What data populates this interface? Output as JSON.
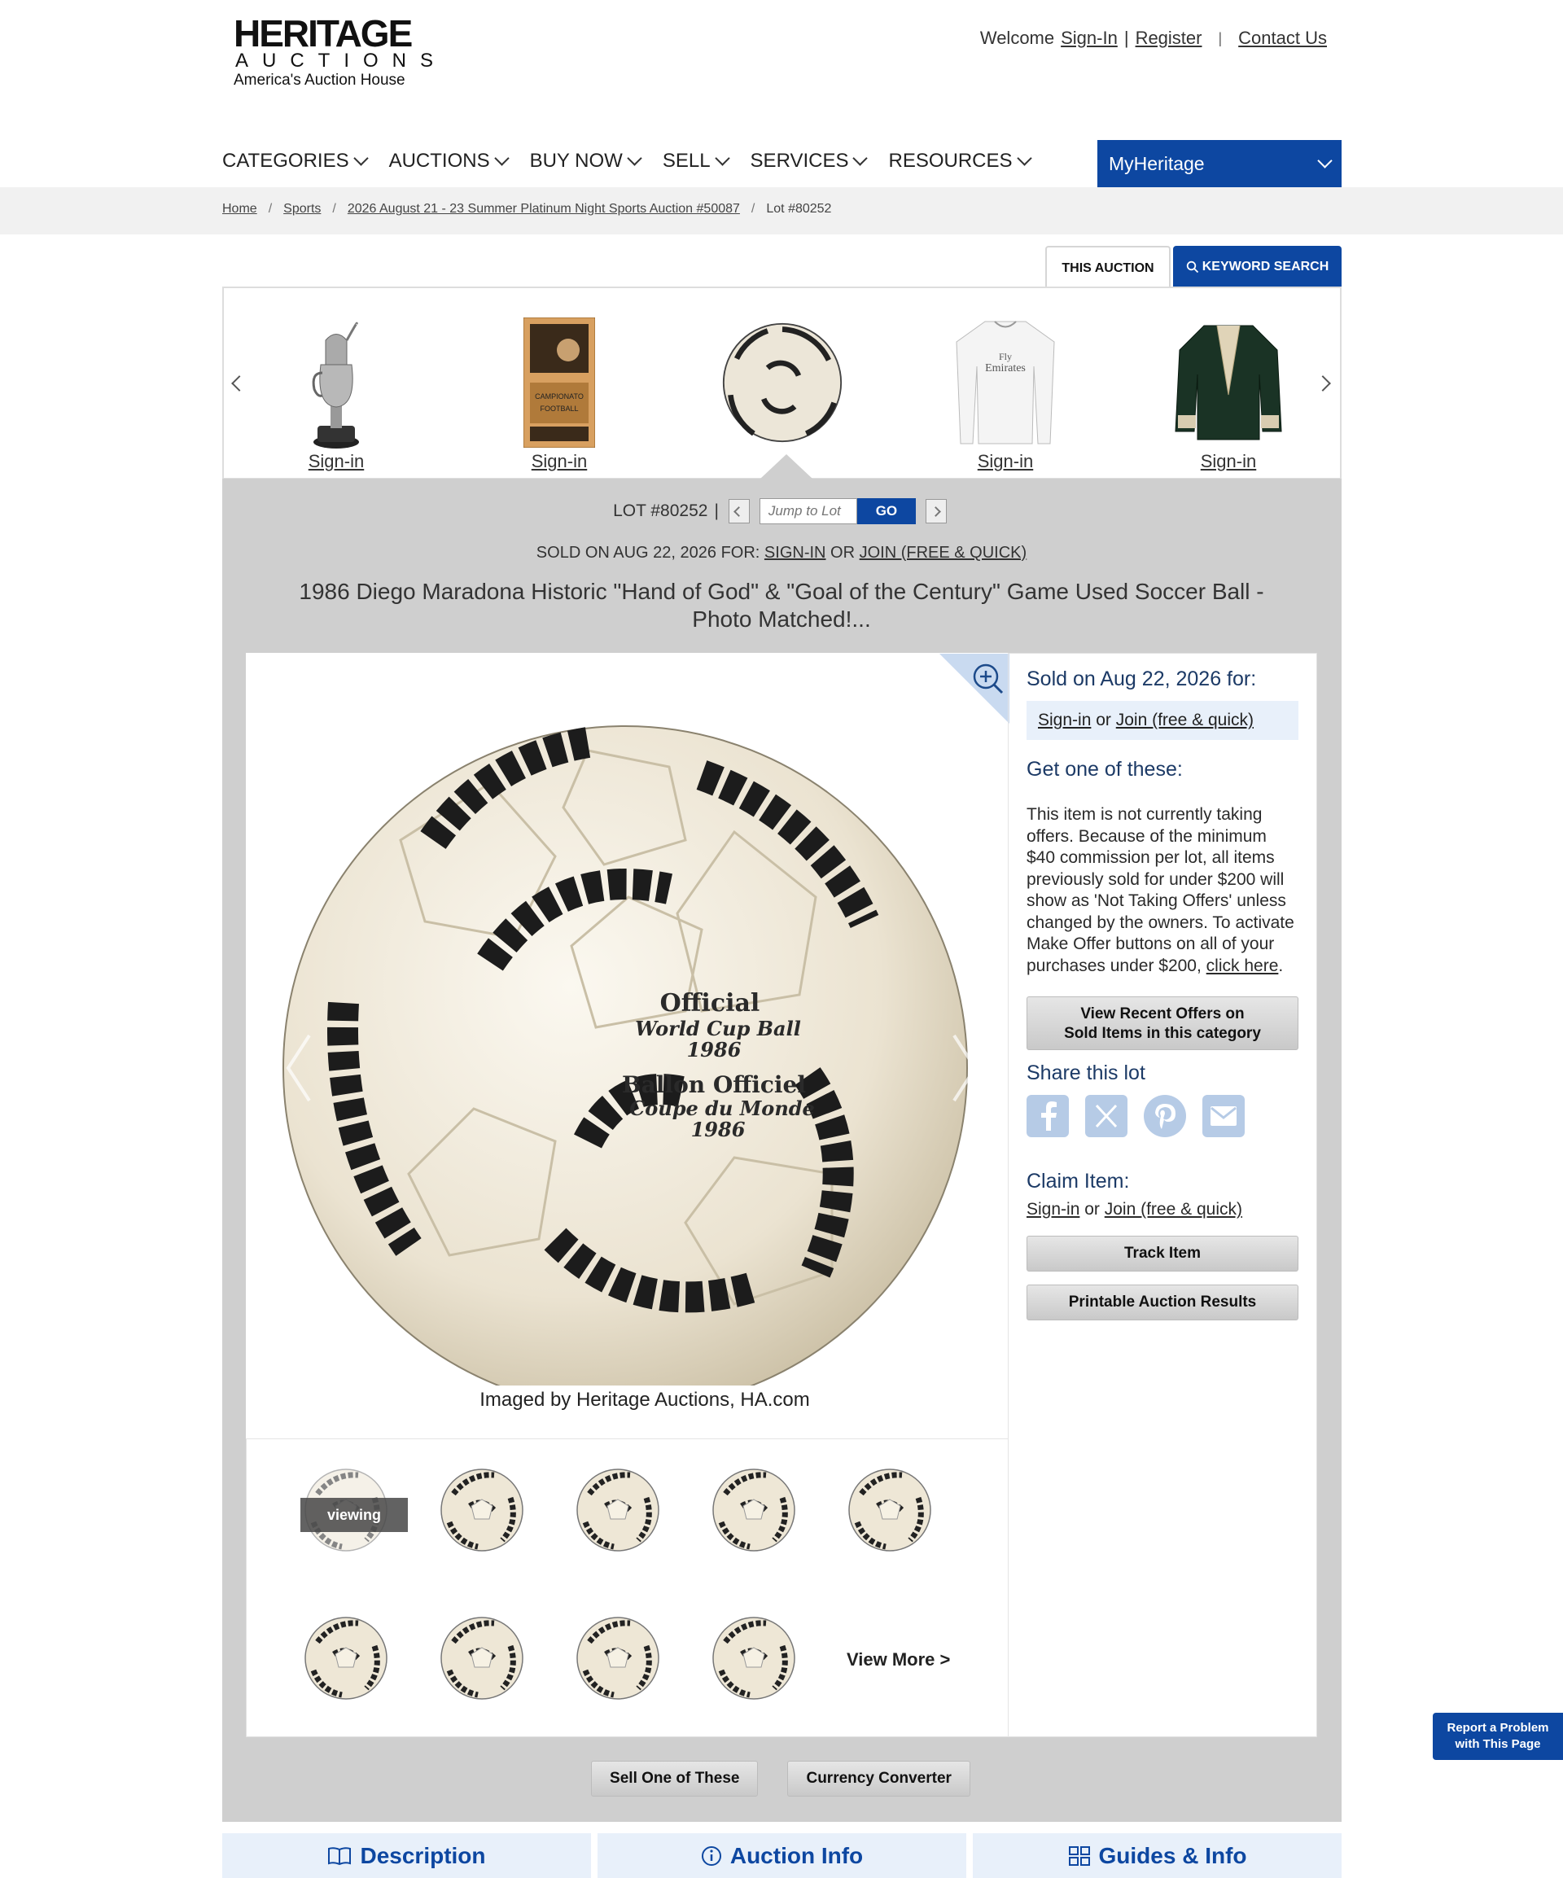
{
  "header": {
    "logo_line1": "HERITAGE",
    "logo_line2": "AUCTIONS",
    "logo_line3": "America's Auction House",
    "welcome": "Welcome",
    "sign_in": "Sign-In",
    "pipe": "|",
    "register": "Register",
    "contact": "Contact Us"
  },
  "nav": {
    "items": [
      "CATEGORIES",
      "AUCTIONS",
      "BUY NOW",
      "SELL",
      "SERVICES",
      "RESOURCES"
    ],
    "myheritage": "MyHeritage"
  },
  "breadcrumb": {
    "home": "Home",
    "sports": "Sports",
    "auction": "2026 August 21 - 23 Summer Platinum Night Sports Auction #50087",
    "lot": "Lot #80252",
    "sep": "/"
  },
  "tabs": {
    "this_auction": "THIS AUCTION",
    "keyword_search": "KEYWORD SEARCH"
  },
  "carousel": {
    "items": [
      {
        "label": "Sign-in",
        "icon": "claret-jug-trophy"
      },
      {
        "label": "Sign-in",
        "icon": "vintage-poster"
      },
      {
        "label": "",
        "icon": "soccer-ball"
      },
      {
        "label": "Sign-in",
        "icon": "white-jersey"
      },
      {
        "label": "Sign-in",
        "icon": "green-jacket"
      }
    ]
  },
  "lot": {
    "lot_label": "LOT #80252",
    "pipe": "|",
    "jump_placeholder": "Jump to Lot",
    "go": "GO",
    "sold_prefix": "SOLD ON AUG 22, 2026 FOR:",
    "sold_signin": "SIGN-IN",
    "sold_or": "OR",
    "sold_join": "JOIN (FREE & QUICK)",
    "title": "1986 Diego Maradona Historic \"Hand of God\" & \"Goal of the Century\" Game Used Soccer Ball - Photo Matched!..."
  },
  "image": {
    "caption": "Imaged by Heritage Auctions, HA.com",
    "ball_text": [
      "Official",
      "World Cup Ball",
      "1986",
      "Ballon Officiel",
      "Coupe du Monde",
      "1986"
    ],
    "viewing": "viewing",
    "view_more": "View More >"
  },
  "sidebar": {
    "sold_heading": "Sold on Aug 22, 2026 for:",
    "signin": "Sign-in",
    "or": "or",
    "join": "Join (free & quick)",
    "get_one": "Get one of these:",
    "paragraph": "This item is not currently taking offers. Because of the minimum $40 commission per lot, all items previously sold for under $200 will show as 'Not Taking Offers' unless changed by the owners. To activate Make Offer buttons on all of your purchases under $200,",
    "click_here": "click here",
    "period": ".",
    "view_offers_btn_l1": "View Recent Offers on",
    "view_offers_btn_l2": "Sold Items in this category",
    "share_heading": "Share this lot",
    "share_icons": [
      "facebook-icon",
      "x-icon",
      "pinterest-icon",
      "email-icon"
    ],
    "claim_heading": "Claim Item:",
    "track_btn": "Track Item",
    "print_btn": "Printable Auction Results"
  },
  "bottom": {
    "sell_btn": "Sell One of These",
    "currency_btn": "Currency Converter"
  },
  "info_tabs": [
    "Description",
    "Auction Info",
    "Guides & Info"
  ],
  "report": {
    "line1": "Report a Problem",
    "line2": "with This Page"
  },
  "colors": {
    "brand_blue": "#0d47a1",
    "band_gray": "#cfcfcf",
    "light_blue": "#e8f0fa"
  }
}
